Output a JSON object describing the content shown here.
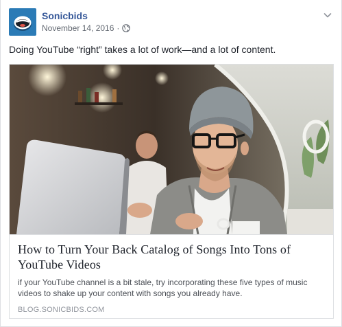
{
  "post": {
    "page_name": "Sonicbids",
    "date": "November 14, 2016",
    "separator": "·",
    "privacy_icon": "globe-icon",
    "text": "Doing YouTube “right” takes a lot of work—and a lot of content."
  },
  "link": {
    "image_description_icon": "link-preview-photo",
    "title_line1": "How to Turn Your Back Catalog of Songs Into Tons of",
    "title_line2": "YouTube Videos",
    "desc_line1": "if your YouTube channel is a bit stale, try incorporating these five types of music",
    "desc_line2": "videos to shake up your content with songs you already have.",
    "domain": "BLOG.SONICBIDS.COM"
  },
  "colors": {
    "page_name": "#365899",
    "meta": "#616770",
    "text": "#1d2129",
    "border": "#dddfe2",
    "avatar_bg": "#2b7bb6"
  }
}
